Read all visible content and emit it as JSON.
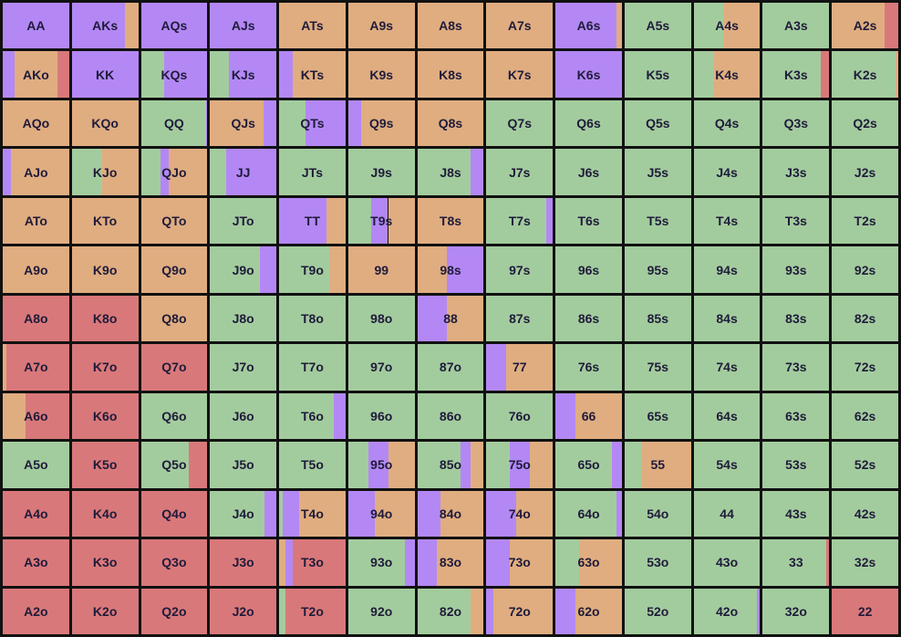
{
  "colors": {
    "raise": "#b388f5",
    "call": "#e0ad80",
    "fold_green": "#a3cc9e",
    "allin_red": "#d9787a"
  },
  "hands": [
    [
      "AA",
      "AKs",
      "AQs",
      "AJs",
      "ATs",
      "A9s",
      "A8s",
      "A7s",
      "A6s",
      "A5s",
      "A4s",
      "A3s",
      "A2s"
    ],
    [
      "AKo",
      "KK",
      "KQs",
      "KJs",
      "KTs",
      "K9s",
      "K8s",
      "K7s",
      "K6s",
      "K5s",
      "K4s",
      "K3s",
      "K2s"
    ],
    [
      "AQo",
      "KQo",
      "QQ",
      "QJs",
      "QTs",
      "Q9s",
      "Q8s",
      "Q7s",
      "Q6s",
      "Q5s",
      "Q4s",
      "Q3s",
      "Q2s"
    ],
    [
      "AJo",
      "KJo",
      "QJo",
      "JJ",
      "JTs",
      "J9s",
      "J8s",
      "J7s",
      "J6s",
      "J5s",
      "J4s",
      "J3s",
      "J2s"
    ],
    [
      "ATo",
      "KTo",
      "QTo",
      "JTo",
      "TT",
      "T9s",
      "T8s",
      "T7s",
      "T6s",
      "T5s",
      "T4s",
      "T3s",
      "T2s"
    ],
    [
      "A9o",
      "K9o",
      "Q9o",
      "J9o",
      "T9o",
      "99",
      "98s",
      "97s",
      "96s",
      "95s",
      "94s",
      "93s",
      "92s"
    ],
    [
      "A8o",
      "K8o",
      "Q8o",
      "J8o",
      "T8o",
      "98o",
      "88",
      "87s",
      "86s",
      "85s",
      "84s",
      "83s",
      "82s"
    ],
    [
      "A7o",
      "K7o",
      "Q7o",
      "J7o",
      "T7o",
      "97o",
      "87o",
      "77",
      "76s",
      "75s",
      "74s",
      "73s",
      "72s"
    ],
    [
      "A6o",
      "K6o",
      "Q6o",
      "J6o",
      "T6o",
      "96o",
      "86o",
      "76o",
      "66",
      "65s",
      "64s",
      "63s",
      "62s"
    ],
    [
      "A5o",
      "K5o",
      "Q5o",
      "J5o",
      "T5o",
      "95o",
      "85o",
      "75o",
      "65o",
      "55",
      "54s",
      "53s",
      "52s"
    ],
    [
      "A4o",
      "K4o",
      "Q4o",
      "J4o",
      "T4o",
      "94o",
      "84o",
      "74o",
      "64o",
      "54o",
      "44",
      "43s",
      "42s"
    ],
    [
      "A3o",
      "K3o",
      "Q3o",
      "J3o",
      "T3o",
      "93o",
      "83o",
      "73o",
      "63o",
      "53o",
      "43o",
      "33",
      "32s"
    ],
    [
      "A2o",
      "K2o",
      "Q2o",
      "J2o",
      "T2o",
      "92o",
      "82o",
      "72o",
      "62o",
      "52o",
      "42o",
      "32o",
      "22"
    ]
  ],
  "frequencies": [
    [
      [
        [
          "raise",
          1.0
        ]
      ],
      [
        [
          "raise",
          0.8
        ],
        [
          "call",
          0.2
        ]
      ],
      [
        [
          "raise",
          1.0
        ]
      ],
      [
        [
          "raise",
          1.0
        ]
      ],
      [
        [
          "call",
          1.0
        ]
      ],
      [
        [
          "call",
          1.0
        ]
      ],
      [
        [
          "call",
          1.0
        ]
      ],
      [
        [
          "call",
          1.0
        ]
      ],
      [
        [
          "raise",
          0.92
        ],
        [
          "call",
          0.08
        ]
      ],
      [
        [
          "fold_green",
          1.0
        ]
      ],
      [
        [
          "fold_green",
          0.45
        ],
        [
          "call",
          0.55
        ]
      ],
      [
        [
          "fold_green",
          1.0
        ]
      ],
      [
        [
          "call",
          0.8
        ],
        [
          "allin_red",
          0.2
        ]
      ]
    ],
    [
      [
        [
          "raise",
          0.18
        ],
        [
          "call",
          0.64
        ],
        [
          "allin_red",
          0.18
        ]
      ],
      [
        [
          "raise",
          1.0
        ]
      ],
      [
        [
          "fold_green",
          0.35
        ],
        [
          "raise",
          0.65
        ]
      ],
      [
        [
          "fold_green",
          0.28
        ],
        [
          "raise",
          0.72
        ]
      ],
      [
        [
          "raise",
          0.2
        ],
        [
          "call",
          0.8
        ]
      ],
      [
        [
          "call",
          1.0
        ]
      ],
      [
        [
          "call",
          1.0
        ]
      ],
      [
        [
          "call",
          1.0
        ]
      ],
      [
        [
          "raise",
          1.0
        ]
      ],
      [
        [
          "fold_green",
          1.0
        ]
      ],
      [
        [
          "fold_green",
          0.3
        ],
        [
          "call",
          0.7
        ]
      ],
      [
        [
          "fold_green",
          0.88
        ],
        [
          "allin_red",
          0.12
        ]
      ],
      [
        [
          "fold_green",
          0.96
        ],
        [
          "call",
          0.04
        ]
      ]
    ],
    [
      [
        [
          "call",
          1.0
        ]
      ],
      [
        [
          "call",
          1.0
        ]
      ],
      [
        [
          "fold_green",
          0.98
        ],
        [
          "raise",
          0.02
        ]
      ],
      [
        [
          "call",
          0.8
        ],
        [
          "raise",
          0.2
        ]
      ],
      [
        [
          "fold_green",
          0.4
        ],
        [
          "raise",
          0.6
        ]
      ],
      [
        [
          "raise",
          0.2
        ],
        [
          "call",
          0.8
        ]
      ],
      [
        [
          "call",
          1.0
        ]
      ],
      [
        [
          "fold_green",
          1.0
        ]
      ],
      [
        [
          "fold_green",
          1.0
        ]
      ],
      [
        [
          "fold_green",
          1.0
        ]
      ],
      [
        [
          "fold_green",
          1.0
        ]
      ],
      [
        [
          "fold_green",
          1.0
        ]
      ],
      [
        [
          "fold_green",
          1.0
        ]
      ]
    ],
    [
      [
        [
          "raise",
          0.12
        ],
        [
          "call",
          0.88
        ]
      ],
      [
        [
          "fold_green",
          0.45
        ],
        [
          "call",
          0.55
        ]
      ],
      [
        [
          "fold_green",
          0.3
        ],
        [
          "raise",
          0.12
        ],
        [
          "call",
          0.58
        ]
      ],
      [
        [
          "fold_green",
          0.25
        ],
        [
          "raise",
          0.75
        ]
      ],
      [
        [
          "fold_green",
          1.0
        ]
      ],
      [
        [
          "fold_green",
          1.0
        ]
      ],
      [
        [
          "fold_green",
          0.8
        ],
        [
          "raise",
          0.2
        ]
      ],
      [
        [
          "fold_green",
          1.0
        ]
      ],
      [
        [
          "fold_green",
          1.0
        ]
      ],
      [
        [
          "fold_green",
          1.0
        ]
      ],
      [
        [
          "fold_green",
          1.0
        ]
      ],
      [
        [
          "fold_green",
          1.0
        ]
      ],
      [
        [
          "fold_green",
          1.0
        ]
      ]
    ],
    [
      [
        [
          "call",
          1.0
        ]
      ],
      [
        [
          "call",
          1.0
        ]
      ],
      [
        [
          "call",
          1.0
        ]
      ],
      [
        [
          "fold_green",
          1.0
        ]
      ],
      [
        [
          "raise",
          0.72
        ],
        [
          "call",
          0.28
        ]
      ],
      [
        [
          "fold_green",
          0.35
        ],
        [
          "raise",
          0.25
        ],
        [
          "call",
          0.4
        ]
      ],
      [
        [
          "call",
          1.0
        ]
      ],
      [
        [
          "fold_green",
          0.9
        ],
        [
          "raise",
          0.1
        ]
      ],
      [
        [
          "fold_green",
          1.0
        ]
      ],
      [
        [
          "fold_green",
          1.0
        ]
      ],
      [
        [
          "fold_green",
          1.0
        ]
      ],
      [
        [
          "fold_green",
          1.0
        ]
      ],
      [
        [
          "fold_green",
          1.0
        ]
      ]
    ],
    [
      [
        [
          "call",
          1.0
        ]
      ],
      [
        [
          "call",
          1.0
        ]
      ],
      [
        [
          "call",
          1.0
        ]
      ],
      [
        [
          "fold_green",
          0.75
        ],
        [
          "raise",
          0.25
        ]
      ],
      [
        [
          "fold_green",
          0.75
        ],
        [
          "call",
          0.25
        ]
      ],
      [
        [
          "call",
          1.0
        ]
      ],
      [
        [
          "call",
          0.45
        ],
        [
          "raise",
          0.55
        ]
      ],
      [
        [
          "fold_green",
          1.0
        ]
      ],
      [
        [
          "fold_green",
          1.0
        ]
      ],
      [
        [
          "fold_green",
          1.0
        ]
      ],
      [
        [
          "fold_green",
          1.0
        ]
      ],
      [
        [
          "fold_green",
          1.0
        ]
      ],
      [
        [
          "fold_green",
          1.0
        ]
      ]
    ],
    [
      [
        [
          "allin_red",
          1.0
        ]
      ],
      [
        [
          "allin_red",
          1.0
        ]
      ],
      [
        [
          "call",
          1.0
        ]
      ],
      [
        [
          "fold_green",
          1.0
        ]
      ],
      [
        [
          "fold_green",
          1.0
        ]
      ],
      [
        [
          "fold_green",
          1.0
        ]
      ],
      [
        [
          "raise",
          0.45
        ],
        [
          "call",
          0.55
        ]
      ],
      [
        [
          "fold_green",
          1.0
        ]
      ],
      [
        [
          "fold_green",
          1.0
        ]
      ],
      [
        [
          "fold_green",
          1.0
        ]
      ],
      [
        [
          "fold_green",
          1.0
        ]
      ],
      [
        [
          "fold_green",
          1.0
        ]
      ],
      [
        [
          "fold_green",
          1.0
        ]
      ]
    ],
    [
      [
        [
          "call",
          0.05
        ],
        [
          "allin_red",
          0.95
        ]
      ],
      [
        [
          "allin_red",
          1.0
        ]
      ],
      [
        [
          "allin_red",
          1.0
        ]
      ],
      [
        [
          "fold_green",
          1.0
        ]
      ],
      [
        [
          "fold_green",
          1.0
        ]
      ],
      [
        [
          "fold_green",
          1.0
        ]
      ],
      [
        [
          "fold_green",
          1.0
        ]
      ],
      [
        [
          "raise",
          0.3
        ],
        [
          "call",
          0.7
        ]
      ],
      [
        [
          "fold_green",
          1.0
        ]
      ],
      [
        [
          "fold_green",
          1.0
        ]
      ],
      [
        [
          "fold_green",
          1.0
        ]
      ],
      [
        [
          "fold_green",
          1.0
        ]
      ],
      [
        [
          "fold_green",
          1.0
        ]
      ]
    ],
    [
      [
        [
          "call",
          0.35
        ],
        [
          "allin_red",
          0.65
        ]
      ],
      [
        [
          "allin_red",
          1.0
        ]
      ],
      [
        [
          "fold_green",
          1.0
        ]
      ],
      [
        [
          "fold_green",
          1.0
        ]
      ],
      [
        [
          "fold_green",
          0.82
        ],
        [
          "raise",
          0.18
        ]
      ],
      [
        [
          "fold_green",
          1.0
        ]
      ],
      [
        [
          "fold_green",
          1.0
        ]
      ],
      [
        [
          "fold_green",
          1.0
        ]
      ],
      [
        [
          "raise",
          0.3
        ],
        [
          "call",
          0.7
        ]
      ],
      [
        [
          "fold_green",
          1.0
        ]
      ],
      [
        [
          "fold_green",
          1.0
        ]
      ],
      [
        [
          "fold_green",
          1.0
        ]
      ],
      [
        [
          "fold_green",
          1.0
        ]
      ]
    ],
    [
      [
        [
          "fold_green",
          1.0
        ]
      ],
      [
        [
          "allin_red",
          1.0
        ]
      ],
      [
        [
          "fold_green",
          0.72
        ],
        [
          "allin_red",
          0.28
        ]
      ],
      [
        [
          "fold_green",
          1.0
        ]
      ],
      [
        [
          "fold_green",
          1.0
        ]
      ],
      [
        [
          "fold_green",
          0.3
        ],
        [
          "raise",
          0.3
        ],
        [
          "call",
          0.4
        ]
      ],
      [
        [
          "fold_green",
          0.65
        ],
        [
          "raise",
          0.15
        ],
        [
          "call",
          0.2
        ]
      ],
      [
        [
          "fold_green",
          0.35
        ],
        [
          "raise",
          0.3
        ],
        [
          "call",
          0.35
        ]
      ],
      [
        [
          "fold_green",
          0.85
        ],
        [
          "raise",
          0.15
        ]
      ],
      [
        [
          "fold_green",
          0.25
        ],
        [
          "call",
          0.75
        ]
      ],
      [
        [
          "fold_green",
          1.0
        ]
      ],
      [
        [
          "fold_green",
          1.0
        ]
      ],
      [
        [
          "fold_green",
          1.0
        ]
      ]
    ],
    [
      [
        [
          "allin_red",
          1.0
        ]
      ],
      [
        [
          "allin_red",
          1.0
        ]
      ],
      [
        [
          "allin_red",
          1.0
        ]
      ],
      [
        [
          "fold_green",
          0.82
        ],
        [
          "raise",
          0.18
        ]
      ],
      [
        [
          "fold_green",
          0.05
        ],
        [
          "raise",
          0.25
        ],
        [
          "call",
          0.7
        ]
      ],
      [
        [
          "raise",
          0.4
        ],
        [
          "call",
          0.6
        ]
      ],
      [
        [
          "raise",
          0.35
        ],
        [
          "call",
          0.65
        ]
      ],
      [
        [
          "raise",
          0.45
        ],
        [
          "call",
          0.55
        ]
      ],
      [
        [
          "fold_green",
          0.92
        ],
        [
          "raise",
          0.08
        ]
      ],
      [
        [
          "fold_green",
          1.0
        ]
      ],
      [
        [
          "fold_green",
          1.0
        ]
      ],
      [
        [
          "fold_green",
          1.0
        ]
      ],
      [
        [
          "fold_green",
          1.0
        ]
      ]
    ],
    [
      [
        [
          "allin_red",
          1.0
        ]
      ],
      [
        [
          "allin_red",
          1.0
        ]
      ],
      [
        [
          "allin_red",
          1.0
        ]
      ],
      [
        [
          "allin_red",
          1.0
        ]
      ],
      [
        [
          "call",
          0.1
        ],
        [
          "raise",
          0.1
        ],
        [
          "allin_red",
          0.8
        ]
      ],
      [
        [
          "fold_green",
          0.85
        ],
        [
          "raise",
          0.15
        ]
      ],
      [
        [
          "raise",
          0.3
        ],
        [
          "call",
          0.7
        ]
      ],
      [
        [
          "raise",
          0.35
        ],
        [
          "call",
          0.65
        ]
      ],
      [
        [
          "fold_green",
          0.35
        ],
        [
          "call",
          0.65
        ]
      ],
      [
        [
          "fold_green",
          1.0
        ]
      ],
      [
        [
          "fold_green",
          1.0
        ]
      ],
      [
        [
          "fold_green",
          0.96
        ],
        [
          "allin_red",
          0.04
        ]
      ],
      [
        [
          "fold_green",
          1.0
        ]
      ]
    ],
    [
      [
        [
          "allin_red",
          1.0
        ]
      ],
      [
        [
          "allin_red",
          1.0
        ]
      ],
      [
        [
          "allin_red",
          1.0
        ]
      ],
      [
        [
          "allin_red",
          1.0
        ]
      ],
      [
        [
          "fold_green",
          0.1
        ],
        [
          "allin_red",
          0.9
        ]
      ],
      [
        [
          "fold_green",
          1.0
        ]
      ],
      [
        [
          "fold_green",
          0.8
        ],
        [
          "call",
          0.2
        ]
      ],
      [
        [
          "raise",
          0.1
        ],
        [
          "call",
          0.9
        ]
      ],
      [
        [
          "raise",
          0.3
        ],
        [
          "call",
          0.7
        ]
      ],
      [
        [
          "fold_green",
          1.0
        ]
      ],
      [
        [
          "fold_green",
          0.95
        ],
        [
          "raise",
          0.05
        ]
      ],
      [
        [
          "fold_green",
          1.0
        ]
      ],
      [
        [
          "allin_red",
          1.0
        ]
      ]
    ]
  ]
}
